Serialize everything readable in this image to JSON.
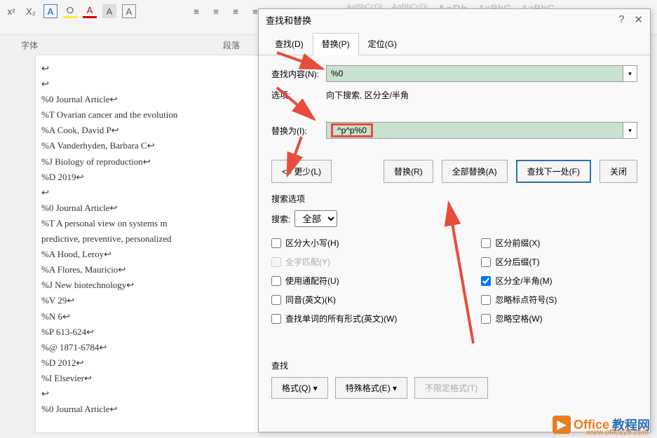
{
  "ribbon": {
    "section_font": "字体",
    "section_para": "段落",
    "styles": [
      "AaBbCcDi",
      "AaBbCcDi",
      "AaBb",
      "AaBbC",
      "AaBbC"
    ]
  },
  "document": {
    "lines": [
      "↩",
      "↩",
      "%0 Journal Article↩",
      "%T Ovarian cancer and the evolution",
      "%A Cook, David P↩",
      "%A Vanderhyden, Barbara C↩",
      "%J Biology of reproduction↩",
      "%D 2019↩",
      "↩",
      "%0 Journal Article↩",
      "%T A personal view on systems m",
      "predictive, preventive, personalized",
      "%A Hood, Leroy↩",
      "%A Flores, Mauricio↩",
      "%J New biotechnology↩",
      "%V 29↩",
      "%N 6↩",
      "%P 613-624↩",
      "%@ 1871-6784↩",
      "%D 2012↩",
      "%I Elsevier↩",
      "↩",
      "%0 Journal Article↩"
    ]
  },
  "dialog": {
    "title": "查找和替换",
    "tabs": {
      "find": "查找(D)",
      "replace": "替换(P)",
      "goto": "定位(G)"
    },
    "find_label": "查找内容(N):",
    "find_value": "%0",
    "options_label": "选项:",
    "options_value": "向下搜索, 区分全/半角",
    "replace_label": "替换为(I):",
    "replace_value": "^p^p%0",
    "buttons": {
      "less": "<< 更少(L)",
      "replace": "替换(R)",
      "replace_all": "全部替换(A)",
      "find_next": "查找下一处(F)",
      "close": "关闭"
    },
    "search_options_label": "搜索选项",
    "search_label": "搜索:",
    "search_dir_value": "全部",
    "checkboxes_left": {
      "case": "区分大小写(H)",
      "whole": "全字匹配(Y)",
      "wildcard": "使用通配符(U)",
      "sounds": "同音(英文)(K)",
      "forms": "查找单词的所有形式(英文)(W)"
    },
    "checkboxes_right": {
      "prefix": "区分前缀(X)",
      "suffix": "区分后缀(T)",
      "fullhalf": "区分全/半角(M)",
      "punct": "忽略标点符号(S)",
      "space": "忽略空格(W)"
    },
    "find_section_label": "查找",
    "format_btn": "格式(Q) ▾",
    "special_btn": "特殊格式(E) ▾",
    "noformat_btn": "不限定格式(T)"
  },
  "watermark": {
    "text1": "Office",
    "text2": "教程网",
    "url": "www.office26.com"
  }
}
